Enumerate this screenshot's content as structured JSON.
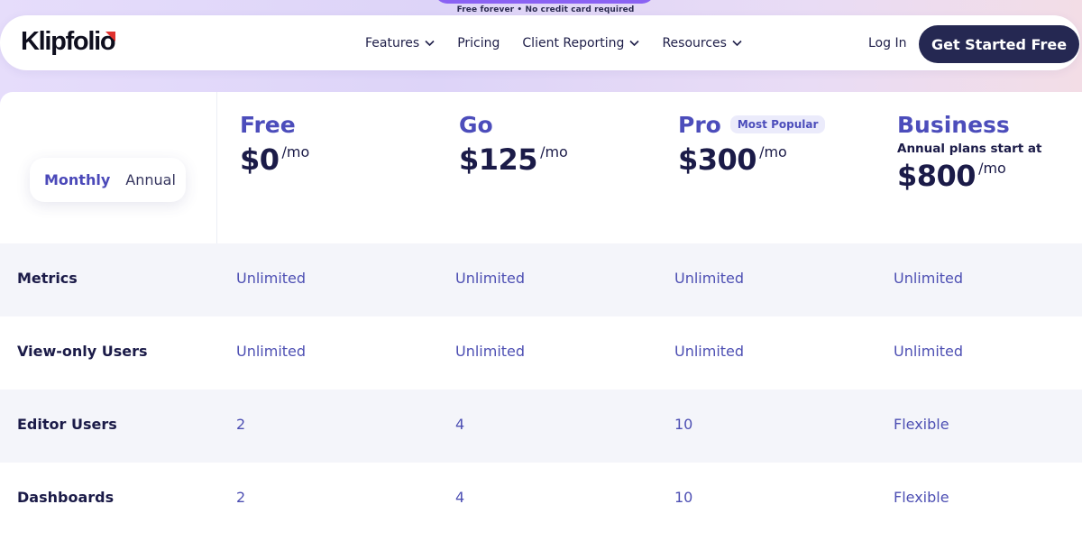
{
  "banner": {
    "text": "Free forever • No credit card required"
  },
  "nav": {
    "logo": "Klipfolio",
    "items": [
      {
        "label": "Features",
        "dropdown": true
      },
      {
        "label": "Pricing",
        "dropdown": false
      },
      {
        "label": "Client Reporting",
        "dropdown": true
      },
      {
        "label": "Resources",
        "dropdown": true
      }
    ],
    "login": "Log In",
    "cta": "Get Started Free"
  },
  "billing_toggle": {
    "monthly": "Monthly",
    "annual": "Annual",
    "selected": "Monthly"
  },
  "plans": [
    {
      "name": "Free",
      "price": "$0",
      "unit": "/mo"
    },
    {
      "name": "Go",
      "price": "$125",
      "unit": "/mo"
    },
    {
      "name": "Pro",
      "price": "$300",
      "unit": "/mo",
      "badge": "Most Popular"
    },
    {
      "name": "Business",
      "price": "$800",
      "unit": "/mo",
      "note": "Annual plans start at"
    }
  ],
  "rows": [
    {
      "label": "Metrics",
      "values": [
        "Unlimited",
        "Unlimited",
        "Unlimited",
        "Unlimited"
      ]
    },
    {
      "label": "View-only Users",
      "values": [
        "Unlimited",
        "Unlimited",
        "Unlimited",
        "Unlimited"
      ]
    },
    {
      "label": "Editor Users",
      "values": [
        "2",
        "4",
        "10",
        "Flexible"
      ]
    },
    {
      "label": "Dashboards",
      "values": [
        "2",
        "4",
        "10",
        "Flexible"
      ]
    }
  ],
  "colors": {
    "accent": "#4c4dbb",
    "cta_background": "#252852",
    "logo_mark": "#e0312e",
    "banner_pill": "#8a62f3"
  }
}
